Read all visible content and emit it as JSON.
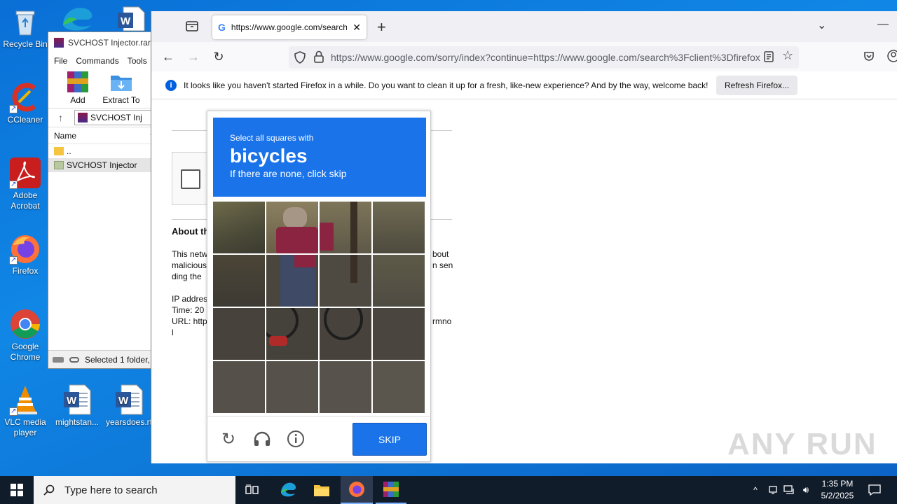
{
  "desktop": {
    "icons": [
      {
        "label": "Recycle Bin"
      },
      {
        "label": "CCleaner"
      },
      {
        "label": "Adobe Acrobat"
      },
      {
        "label": "Firefox"
      },
      {
        "label": "Google Chrome"
      },
      {
        "label": "VLC media player"
      },
      {
        "label": "mightstan..."
      },
      {
        "label": "yearsdoes.rt"
      }
    ]
  },
  "winrar": {
    "title": "SVCHOST Injector.rar",
    "menu": [
      "File",
      "Commands",
      "Tools"
    ],
    "toolbar": [
      "Add",
      "Extract To"
    ],
    "path": "SVCHOST Inj",
    "column_name": "Name",
    "rows": [
      "..",
      "SVCHOST Injector"
    ],
    "status": "Selected 1 folder, 9"
  },
  "browser": {
    "tab_title": "https://www.google.com/search",
    "url_host": "https://www.google.com",
    "url_rest": "/sorry/index?continue=https://www.google.com/search%3Fclient%3Dfirefox",
    "notification": "It looks like you haven't started Firefox in a while. Do you want to clean it up for a fresh, like-new experience? And by the way, welcome back!",
    "refresh_label": "Refresh Firefox..."
  },
  "page": {
    "about_heading": "About th",
    "para_left": [
      "This netw",
      "malicious",
      "ding the"
    ],
    "para_right": [
      "bout",
      "n sen",
      ""
    ],
    "ip_left": [
      "IP addres",
      "Time: 20",
      "URL: http",
      "l"
    ],
    "ip_right": [
      "",
      "",
      "rmno",
      ""
    ]
  },
  "captcha": {
    "select_text": "Select all squares with",
    "target": "bicycles",
    "none_text": "If there are none, click skip",
    "skip_label": "SKIP",
    "header_color": "#1a73e8"
  },
  "taskbar": {
    "search_placeholder": "Type here to search",
    "time": "1:35 PM",
    "date": "5/2/2025"
  },
  "watermark": "ANY RUN"
}
